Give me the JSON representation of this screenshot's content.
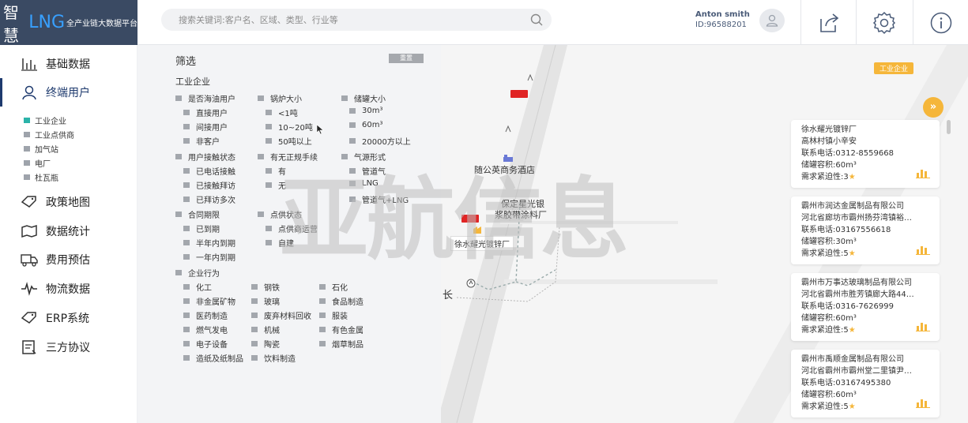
{
  "header": {
    "logo_a": "智慧",
    "logo_b": "LNG",
    "logo_c": "全产业链大数据平台",
    "search_placeholder": "搜索关键词:客户名、区域、类型、行业等",
    "user_name": "Anton smith",
    "user_id": "ID:96588201"
  },
  "sidebar": {
    "items": [
      {
        "label": "基础数据",
        "icon": "bar-chart-icon"
      },
      {
        "label": "终端用户",
        "icon": "user-icon"
      },
      {
        "label": "政策地图",
        "icon": "tag-icon"
      },
      {
        "label": "数据统计",
        "icon": "map-fold-icon"
      },
      {
        "label": "费用预估",
        "icon": "truck-icon"
      },
      {
        "label": "物流数据",
        "icon": "pulse-icon"
      },
      {
        "label": "ERP系统",
        "icon": "tag-icon"
      },
      {
        "label": "三方协议",
        "icon": "document-icon"
      }
    ],
    "subitems": [
      "工业企业",
      "工业点供商",
      "加气站",
      "电厂",
      "杜瓦瓶"
    ]
  },
  "filter": {
    "title": "筛选",
    "reset": "重置",
    "section_industry": "工业企业",
    "row1": [
      "是否海油用户",
      "锅炉大小",
      "储罐大小"
    ],
    "col1a": [
      "直接用户",
      "间接用户",
      "非客户"
    ],
    "col2a": [
      "<1吨",
      "10~20吨",
      "50吨以上"
    ],
    "col3a": [
      "30m³",
      "60m³",
      "20000方以上"
    ],
    "row2": [
      "用户接触状态",
      "有无正规手续",
      "气源形式"
    ],
    "col1b": [
      "已电话接触",
      "已接触拜访",
      "已拜访多次"
    ],
    "col2b": [
      "有",
      "无"
    ],
    "col3b": [
      "管道气",
      "LNG",
      "管道气+LNG"
    ],
    "row3": [
      "合同期限",
      "点供状态"
    ],
    "col1c": [
      "已到期",
      "半年内到期",
      "一年内到期"
    ],
    "col2c": [
      "点供商运营",
      "自建"
    ],
    "section_behavior": "企业行为",
    "behavior_grid": [
      [
        "化工",
        "钢铁",
        "石化"
      ],
      [
        "非金属矿物",
        "玻璃",
        "食品制造"
      ],
      [
        "医药制造",
        "废弃材料回收",
        "服装"
      ],
      [
        "燃气发电",
        "机械",
        "有色金属"
      ],
      [
        "电子设备",
        "陶瓷",
        "烟草制品"
      ],
      [
        "造纸及纸制品",
        "饮料制造",
        ""
      ]
    ]
  },
  "map": {
    "legend": "工业企业",
    "expand": "»",
    "poi1": "随公英商务酒店",
    "poi2a": "保定星光银",
    "poi2b": "浆胶带涂料厂",
    "poi3": "徐水耀光镀锌厂",
    "road_label": "长",
    "watermark": "亚航信息"
  },
  "cards": [
    {
      "name": "徐水耀光镀锌厂",
      "address": "高林村镇小辛安",
      "phone": "联系电话:0312-8559668",
      "tank": "储罐容积:60m³",
      "urgency": "需求紧迫性:3"
    },
    {
      "name": "霸州市润达金属制品有限公司",
      "address": "河北省廊坊市霸州扬芬湾镇裕…",
      "phone": "联系电话:03167556618",
      "tank": "储罐容积:30m³",
      "urgency": "需求紧迫性:5"
    },
    {
      "name": "霸州市万事达玻璃制品有限公司",
      "address": "河北省霸州市胜芳镇廊大路44…",
      "phone": "联系电话:0316-7626999",
      "tank": "储罐容积:60m³",
      "urgency": "需求紧迫性:5"
    },
    {
      "name": "霸州市禹顺金属制品有限公司",
      "address": "河北省霸州市霸州堂二里镇尹…",
      "phone": "联系电话:03167495380",
      "tank": "储罐容积:60m³",
      "urgency": "需求紧迫性:5"
    }
  ],
  "colors": {
    "nav_active": "#1e3a6e",
    "accent": "#f5b63a",
    "marker": "#e02424"
  }
}
